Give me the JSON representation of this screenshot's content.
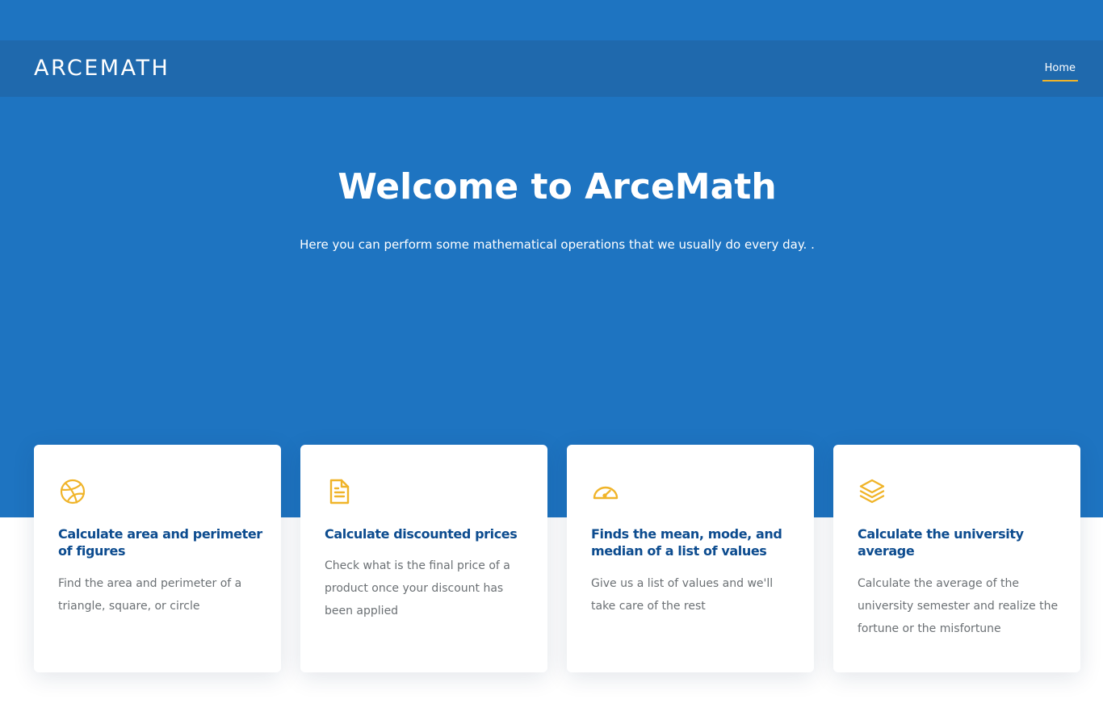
{
  "navbar": {
    "logo": "ARCEMATH",
    "links": [
      {
        "label": "Home",
        "active": true
      }
    ],
    "active_underline_color": "#f0b429"
  },
  "hero": {
    "title": "Welcome to ArceMath",
    "subtitle": "Here you can perform some mathematical operations that we usually do every day. .",
    "background_color": "#1e74c1"
  },
  "cards": [
    {
      "icon": "dribbble-icon",
      "title": "Calculate area and perimeter of figures",
      "description": "Find the area and perimeter of a triangle, square, or circle"
    },
    {
      "icon": "file-text-icon",
      "title": "Calculate discounted prices",
      "description": "Check what is the final price of a product once your discount has been applied"
    },
    {
      "icon": "speedometer-icon",
      "title": "Finds the mean, mode, and median of a list of values",
      "description": "Give us a list of values and we'll take care of the rest"
    },
    {
      "icon": "layers-icon",
      "title": "Calculate the university average",
      "description": "Calculate the average of the university semester and realize the fortune or the misfortune"
    }
  ],
  "colors": {
    "accent": "#f0b429",
    "card_title": "#0d4c8f",
    "card_text": "#6b7074"
  }
}
